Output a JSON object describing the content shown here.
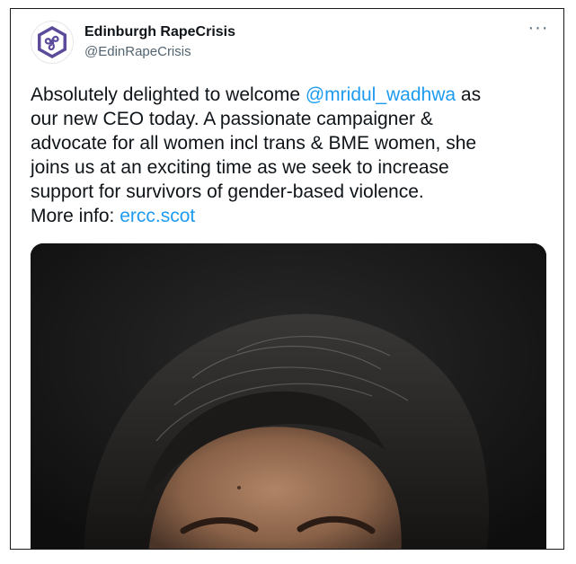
{
  "tweet": {
    "display_name": "Edinburgh RapeCrisis",
    "handle": "@EdinRapeCrisis",
    "more_label": "···",
    "lines": [
      {
        "before": "Absolutely delighted to welcome ",
        "mention": "@mridul_wadhwa",
        "after": " as"
      },
      {
        "text": "our new CEO today. A passionate campaigner &"
      },
      {
        "text": "advocate for all women incl trans & BME women, she"
      },
      {
        "text": "joins us at an exciting time as we seek to increase"
      },
      {
        "text": "support for survivors of gender-based violence."
      },
      {
        "before": "More info: ",
        "link": "ercc.scot"
      }
    ]
  },
  "icons": {
    "avatar": "triskele-logo-icon",
    "more": "more-options-icon"
  },
  "colors": {
    "link": "#1d9bf0",
    "text": "#0f1419",
    "muted": "#536471",
    "logo": "#5b4b9a",
    "photo_bg": "#151515"
  }
}
